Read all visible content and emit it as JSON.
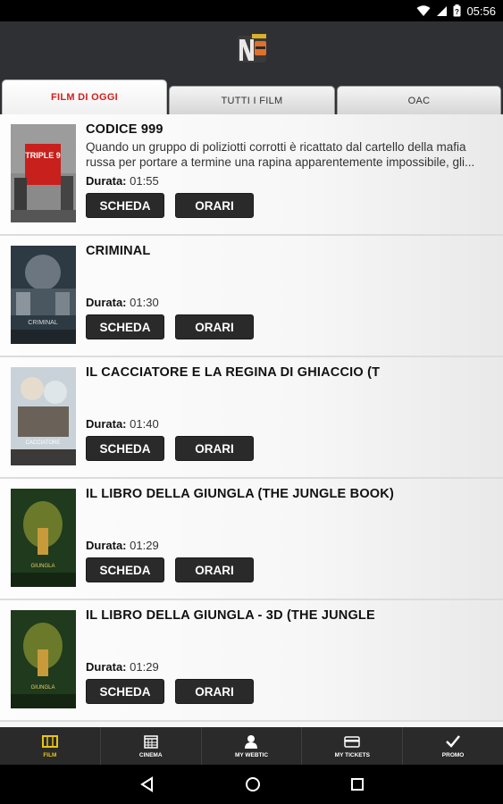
{
  "status_bar": {
    "time": "05:56"
  },
  "tabs": [
    {
      "label": "FILM DI OGGI"
    },
    {
      "label": "TUTTI I FILM"
    },
    {
      "label": "OAC"
    }
  ],
  "movie_labels": {
    "duration": "Durata:",
    "scheda": "SCHEDA",
    "orari": "ORARI"
  },
  "movies": [
    {
      "title": "CODICE 999",
      "description": "Quando un gruppo di poliziotti corrotti è ricattato dal cartello della mafia russa per portare a termine una rapina apparentemente impossibile, gli...",
      "duration": "01:55",
      "poster_icon": "poster-triple9"
    },
    {
      "title": "CRIMINAL",
      "description": "",
      "duration": "01:30",
      "poster_icon": "poster-criminal"
    },
    {
      "title": "IL CACCIATORE E LA REGINA DI GHIACCIO (T",
      "description": "",
      "duration": "01:40",
      "poster_icon": "poster-cacciatore"
    },
    {
      "title": "IL LIBRO DELLA GIUNGLA (THE JUNGLE BOOK)",
      "description": "",
      "duration": "01:29",
      "poster_icon": "poster-jungle-book"
    },
    {
      "title": "IL LIBRO DELLA GIUNGLA - 3D (THE JUNGLE",
      "description": "",
      "duration": "01:29",
      "poster_icon": "poster-jungle-book-3d"
    }
  ],
  "bottom_nav": [
    {
      "label": "FILM",
      "icon": "film-icon",
      "active": true
    },
    {
      "label": "CINEMA",
      "icon": "calendar-icon",
      "active": false
    },
    {
      "label": "MY WEBTIC",
      "icon": "user-icon",
      "active": false
    },
    {
      "label": "MY TICKETS",
      "icon": "ticket-icon",
      "active": false
    },
    {
      "label": "PROMO",
      "icon": "check-icon",
      "active": false
    }
  ],
  "colors": {
    "active_tab_text": "#d1201d",
    "active_nav": "#e7c418",
    "header_bg": "#2f3033"
  }
}
